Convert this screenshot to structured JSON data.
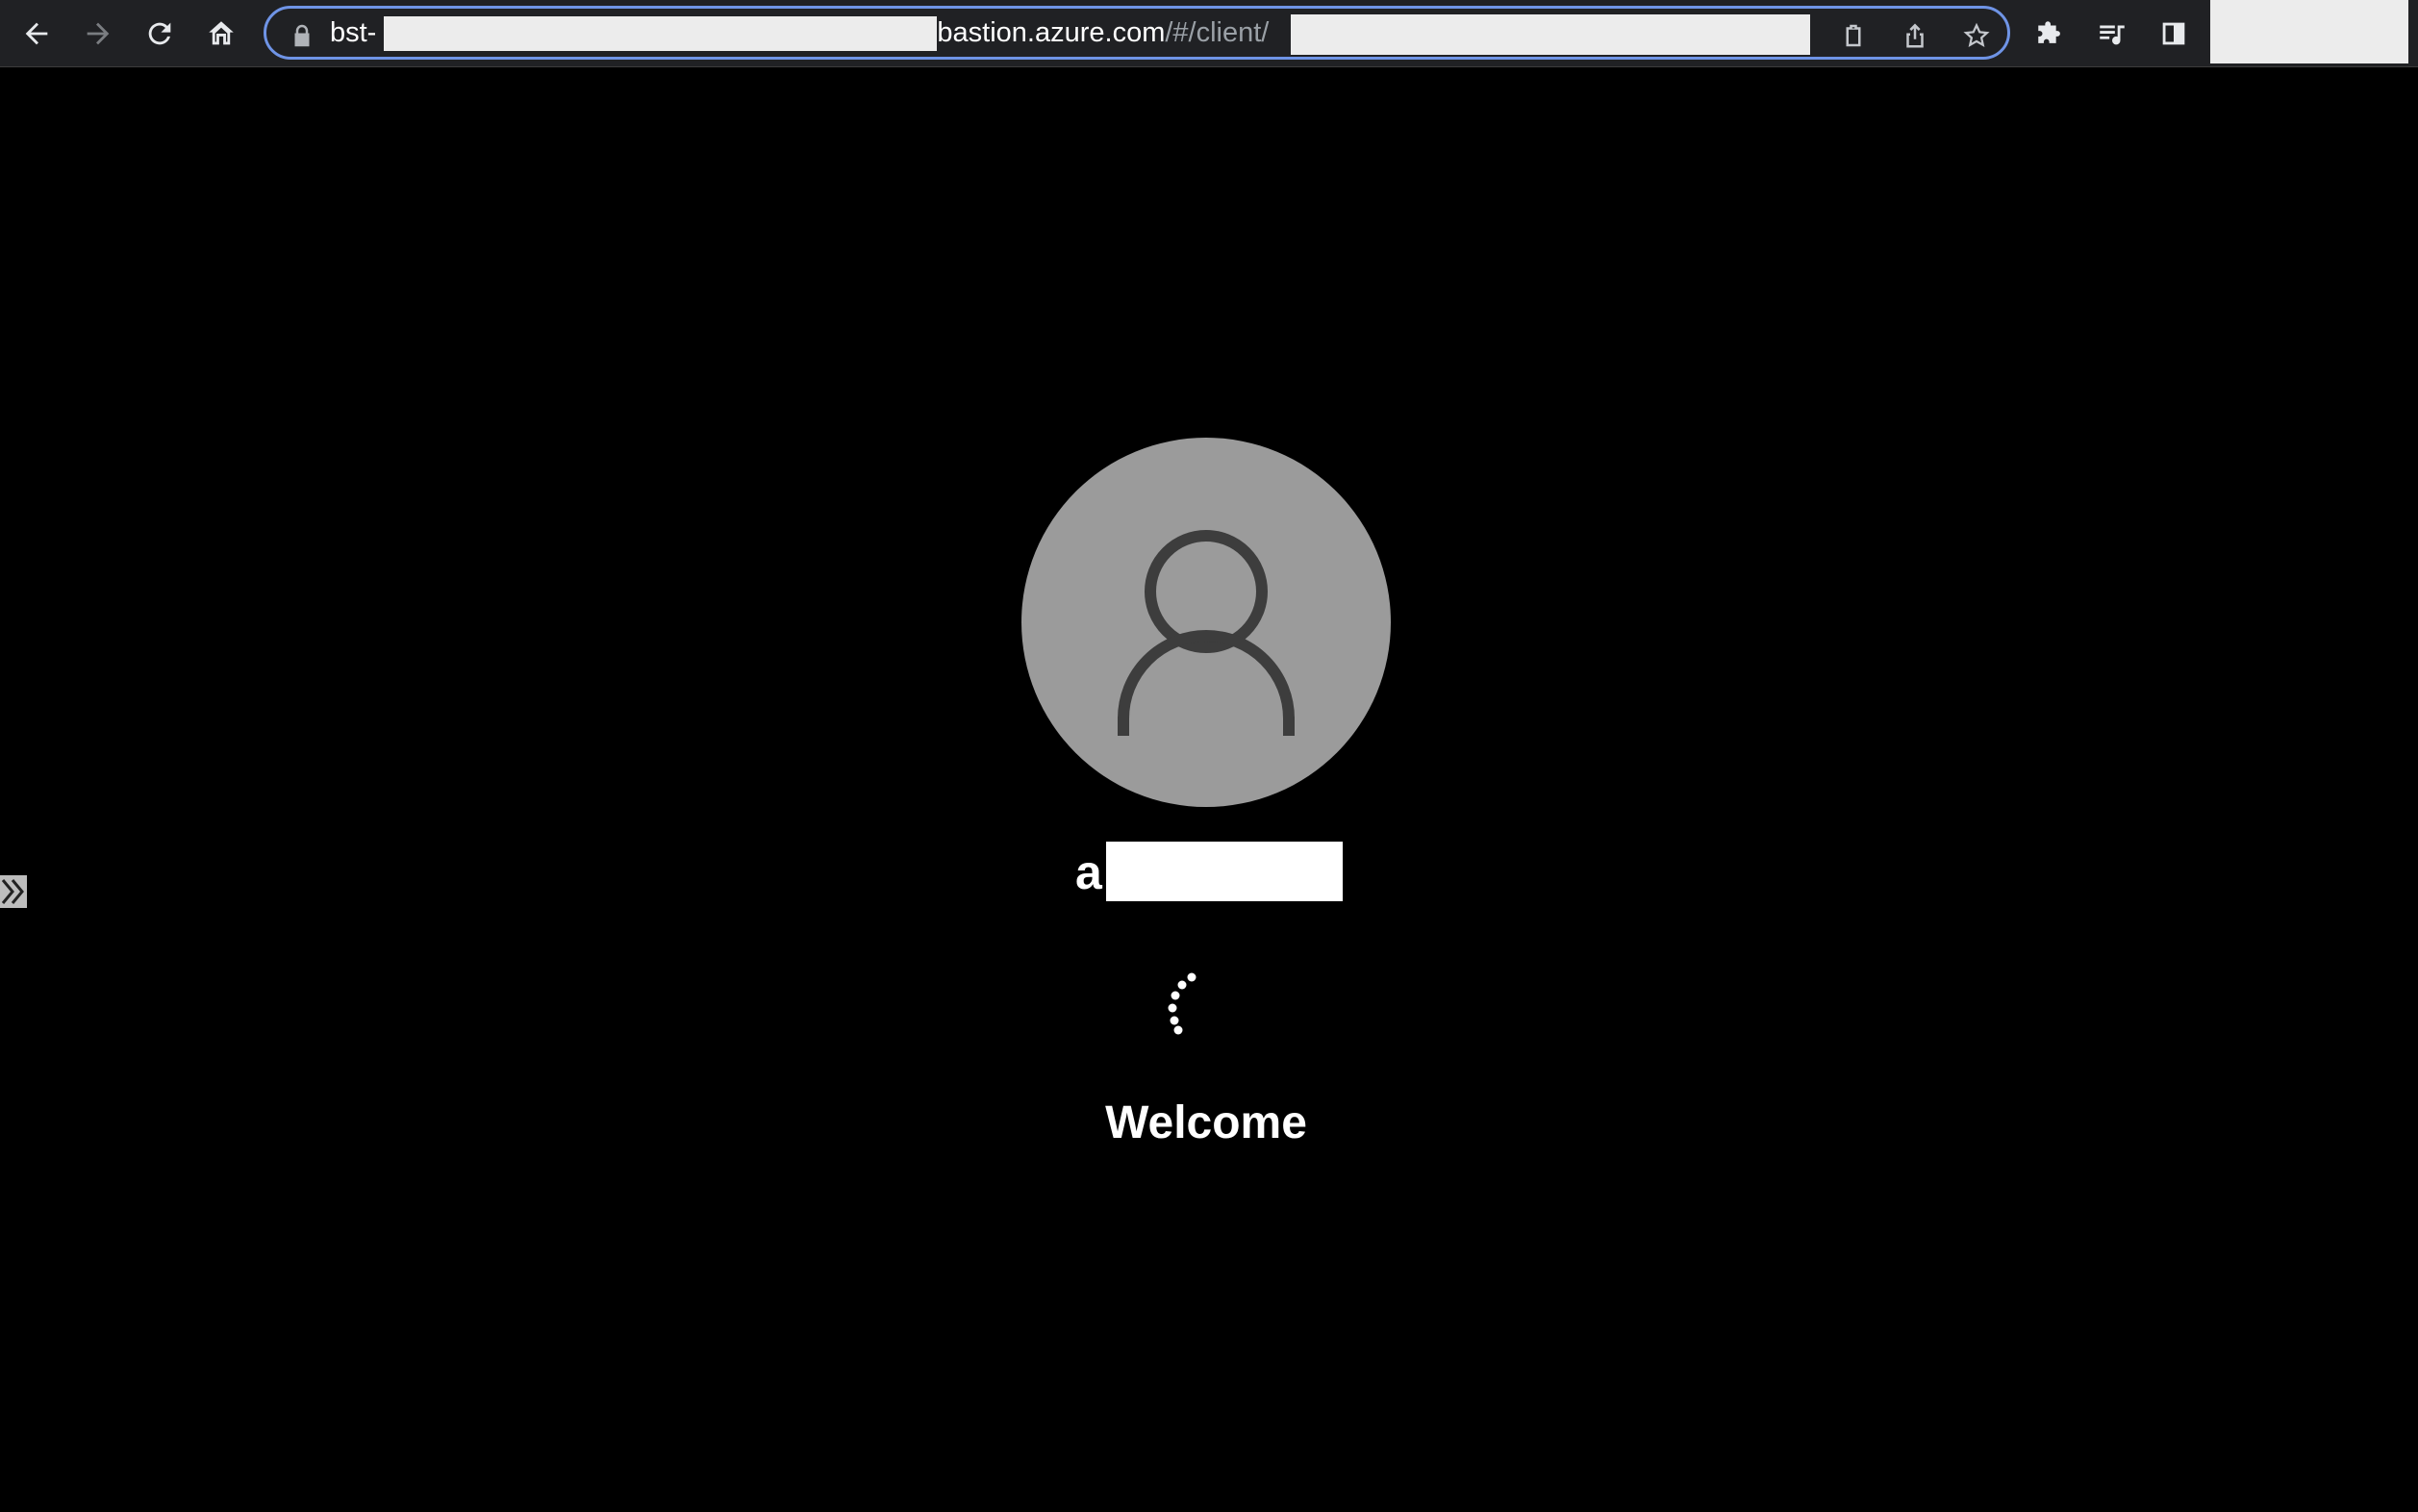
{
  "browser": {
    "url_prefix": "bst-",
    "url_domain": ".bastion.azure.com",
    "url_path": "/#/client/",
    "icons": {
      "back": "arrow-left-icon",
      "forward": "arrow-right-icon",
      "reload": "reload-icon",
      "home": "home-icon",
      "lock": "lock-icon",
      "clipboard": "clipboard-icon",
      "share": "share-icon",
      "bookmark": "star-icon",
      "extensions": "puzzle-icon",
      "media": "media-playlist-icon",
      "sidepanel": "side-panel-icon"
    }
  },
  "session": {
    "username_visible": "a",
    "status_text": "Welcome"
  },
  "colors": {
    "background": "#000000",
    "toolbar": "#202124",
    "omnibox_border": "#6f94e6",
    "avatar": "#9b9b9b",
    "avatar_glyph": "#3d3d3d"
  }
}
